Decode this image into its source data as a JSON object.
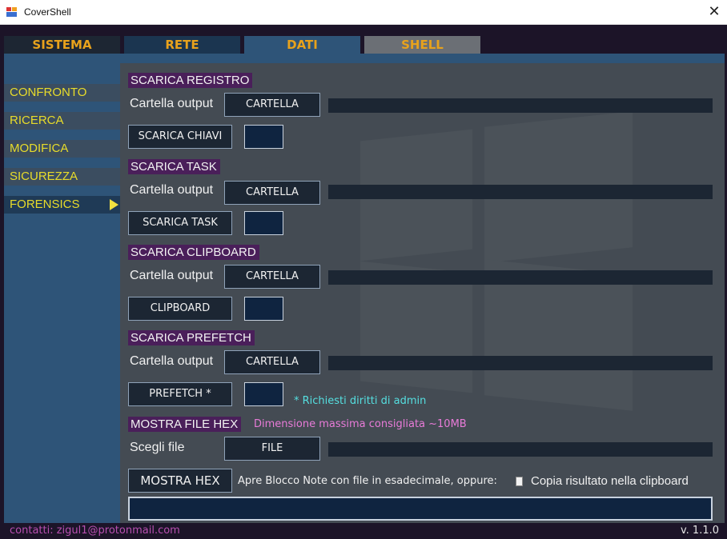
{
  "window": {
    "title": "CoverShell",
    "close_glyph": "✕"
  },
  "tabs": [
    {
      "label": "SISTEMA"
    },
    {
      "label": "RETE"
    },
    {
      "label": "DATI"
    },
    {
      "label": "SHELL"
    }
  ],
  "active_tab": "DATI",
  "sidebar": {
    "items": [
      {
        "label": "CONFRONTO"
      },
      {
        "label": "RICERCA"
      },
      {
        "label": "MODIFICA"
      },
      {
        "label": "SICUREZZA"
      },
      {
        "label": "FORENSICS"
      }
    ],
    "active_item": "FORENSICS"
  },
  "sections": {
    "registro": {
      "title": "SCARICA REGISTRO",
      "output_label": "Cartella output",
      "folder_button": "CARTELLA",
      "action_button": "SCARICA CHIAVI"
    },
    "task": {
      "title": "SCARICA TASK",
      "output_label": "Cartella output",
      "folder_button": "CARTELLA",
      "action_button": "SCARICA TASK"
    },
    "clipboard": {
      "title": "SCARICA CLIPBOARD",
      "output_label": "Cartella output",
      "folder_button": "CARTELLA",
      "action_button": "CLIPBOARD"
    },
    "prefetch": {
      "title": "SCARICA PREFETCH",
      "output_label": "Cartella output",
      "folder_button": "CARTELLA",
      "action_button": "PREFETCH *",
      "note": "* Richiesti diritti di admin"
    },
    "hex": {
      "title": "MOSTRA FILE HEX",
      "size_note": "Dimensione massima consigliata ~10MB",
      "file_label": "Scegli file",
      "file_button": "FILE",
      "action_button": "MOSTRA HEX",
      "description": "Apre Blocco Note con file in esadecimale, oppure:",
      "checkbox_label": "Copia risultato nella clipboard",
      "checkbox_checked": false
    }
  },
  "footer": {
    "contact": "contatti: zigul1@protonmail.com",
    "version": "v. 1.1.0"
  },
  "colors": {
    "accent_tab_text": "#e8a21c",
    "sidebar_text": "#e8dc2a",
    "section_title_bg": "#4a1f5a",
    "note_cyan": "#55dfe0",
    "note_pink": "#e87bd8",
    "contact_text": "#b84fb0"
  }
}
